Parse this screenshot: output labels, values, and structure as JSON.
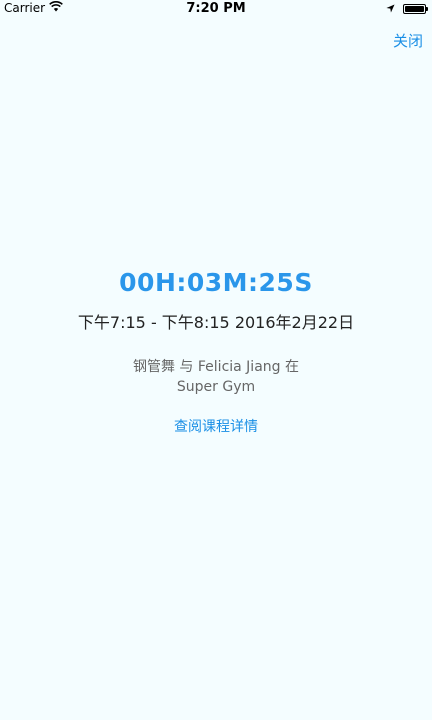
{
  "status_bar": {
    "carrier": "Carrier",
    "time": "7:20 PM",
    "icons": [
      "wifi-icon",
      "location-arrow-icon",
      "battery-icon"
    ]
  },
  "header": {
    "close_label": "关闭"
  },
  "main": {
    "timer": "00H:03M:25S",
    "time_range": "下午7:15 - 下午8:15 2016年2月22日",
    "class_line_1": "钢管舞 与 Felicia Jiang 在",
    "class_line_2": "Super Gym",
    "details_link": "查阅课程详情"
  },
  "colors": {
    "background": "#f4fdff",
    "accent": "#1a8fe6",
    "timer": "#2a96ea"
  }
}
